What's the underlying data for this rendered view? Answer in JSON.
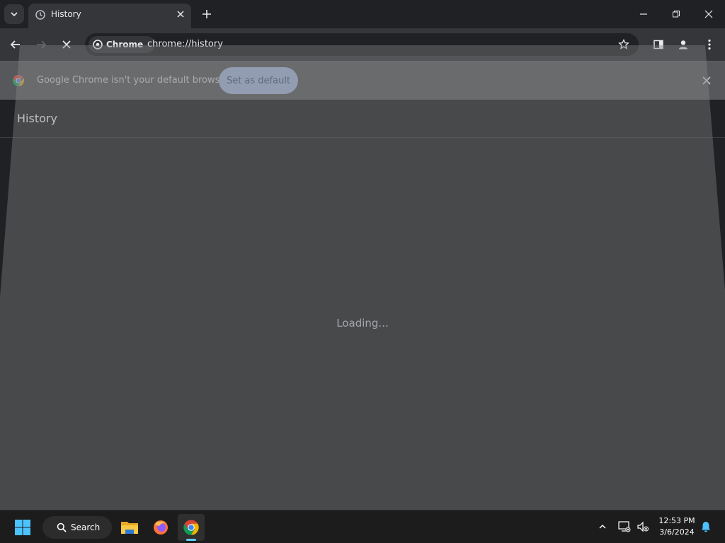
{
  "tab": {
    "title": "History"
  },
  "omnibox": {
    "chip_label": "Chrome",
    "url": "chrome://history"
  },
  "infobar": {
    "message": "Google Chrome isn't your default browser",
    "button_label": "Set as default"
  },
  "page": {
    "title": "History",
    "loading_text": "Loading..."
  },
  "taskbar": {
    "search_label": "Search",
    "time": "12:53 PM",
    "date": "3/6/2024"
  },
  "colors": {
    "accent": "#a8c7fa",
    "taskbar_active": "#60cdff"
  }
}
